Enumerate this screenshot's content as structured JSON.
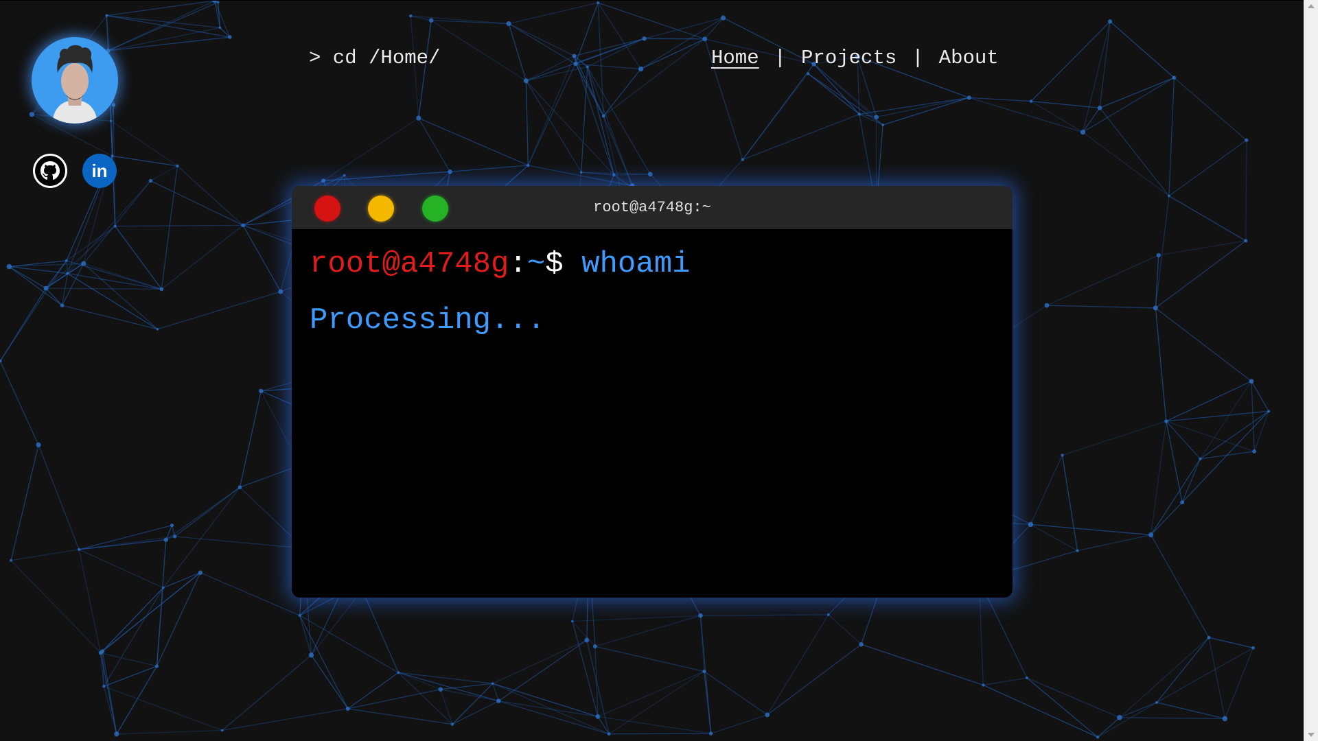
{
  "header": {
    "path": "> cd /Home/"
  },
  "nav": {
    "items": [
      {
        "label": "Home",
        "active": true
      },
      {
        "label": "Projects",
        "active": false
      },
      {
        "label": "About",
        "active": false
      }
    ],
    "separator": "|"
  },
  "sidebar": {
    "avatar_icon": "avatar-portrait",
    "social": [
      {
        "name": "github-icon"
      },
      {
        "name": "linkedin-icon",
        "text": "in"
      }
    ]
  },
  "terminal": {
    "title": "root@a4748g:~",
    "prompt_user": "root@a4748g",
    "prompt_colon": ":",
    "prompt_path": "~$",
    "command": "whoami",
    "output": "Processing...",
    "colors": {
      "red": "#d51313",
      "yellow": "#f5b800",
      "green": "#25b325",
      "accent": "#3e9bff",
      "user": "#e11c1c"
    }
  }
}
